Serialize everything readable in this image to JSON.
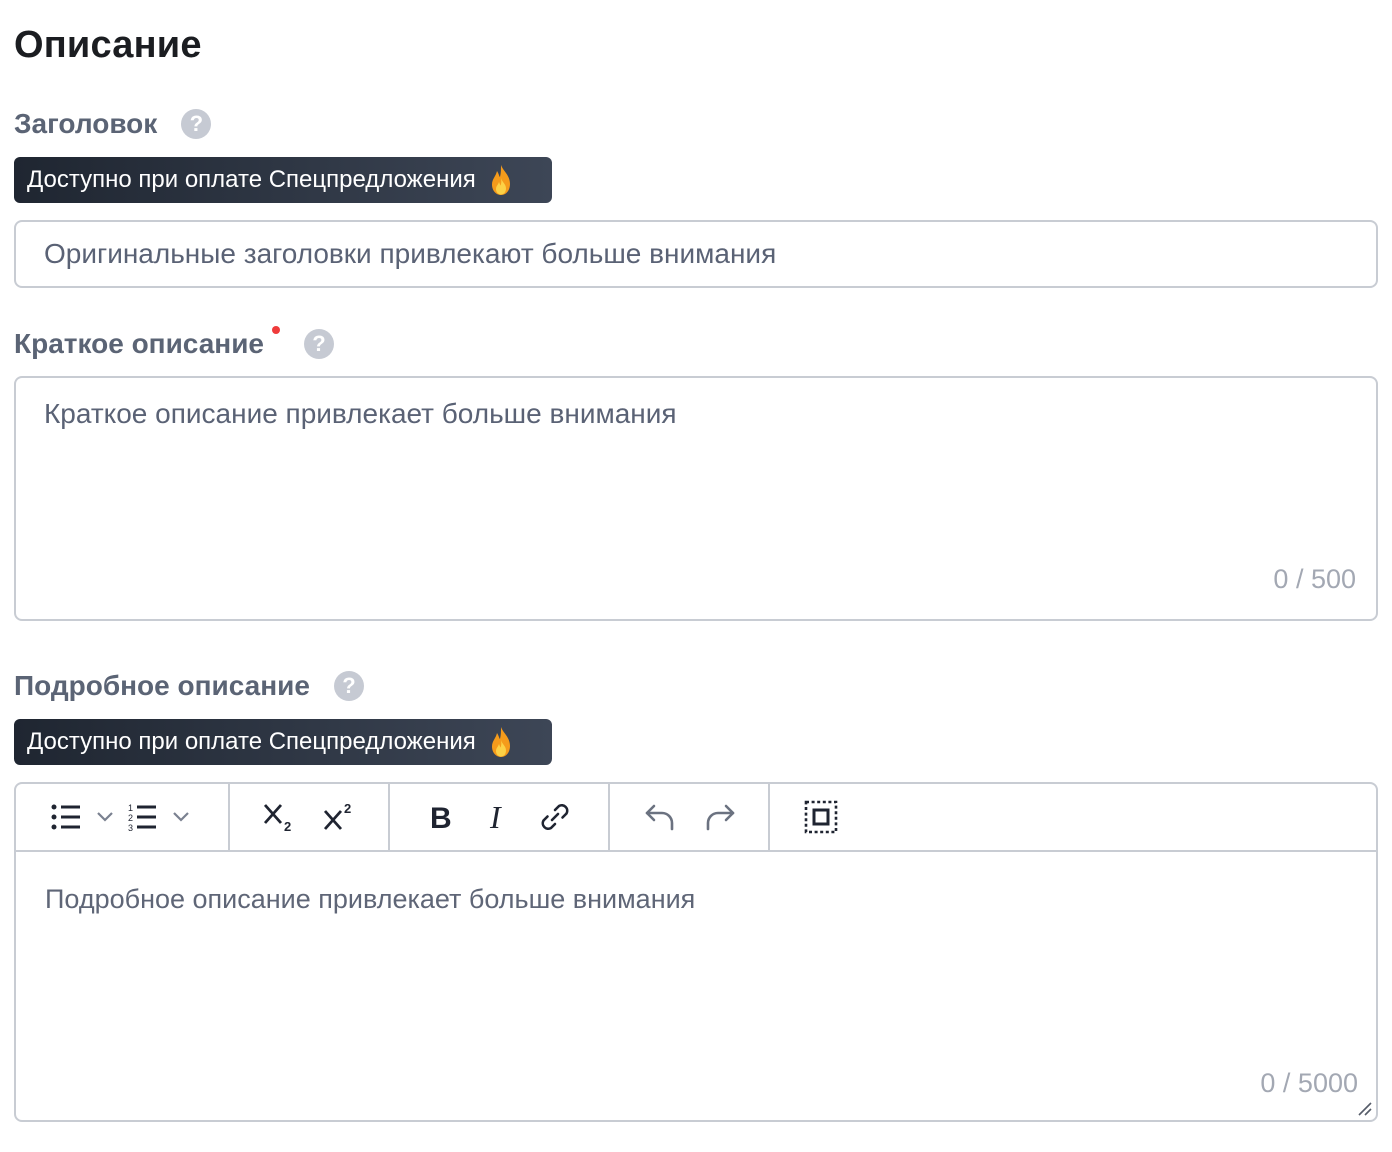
{
  "section": {
    "title": "Описание"
  },
  "headline": {
    "label": "Заголовок",
    "help": "?",
    "promo": "Доступно при оплате Спецпредложения",
    "placeholder": "Оригинальные заголовки привлекают больше внимания"
  },
  "short_description": {
    "label": "Краткое описание",
    "help": "?",
    "required": true,
    "placeholder": "Краткое описание привлекает больше внимания",
    "counter": "0 / 500"
  },
  "long_description": {
    "label": "Подробное описание",
    "help": "?",
    "promo": "Доступно при оплате Спецпредложения",
    "placeholder": "Подробное описание привлекает больше внимания",
    "counter": "0 / 5000",
    "toolbar": [
      "bullet-list",
      "bullet-list-dropdown",
      "numbered-list",
      "numbered-list-dropdown",
      "subscript",
      "superscript",
      "bold",
      "italic",
      "link",
      "undo",
      "redo",
      "select-all"
    ]
  },
  "colors": {
    "promo_start": "#1f2631",
    "promo_end": "#3d4656",
    "required_dot": "#ef3b3b",
    "help_icon": "#c6cad3"
  }
}
